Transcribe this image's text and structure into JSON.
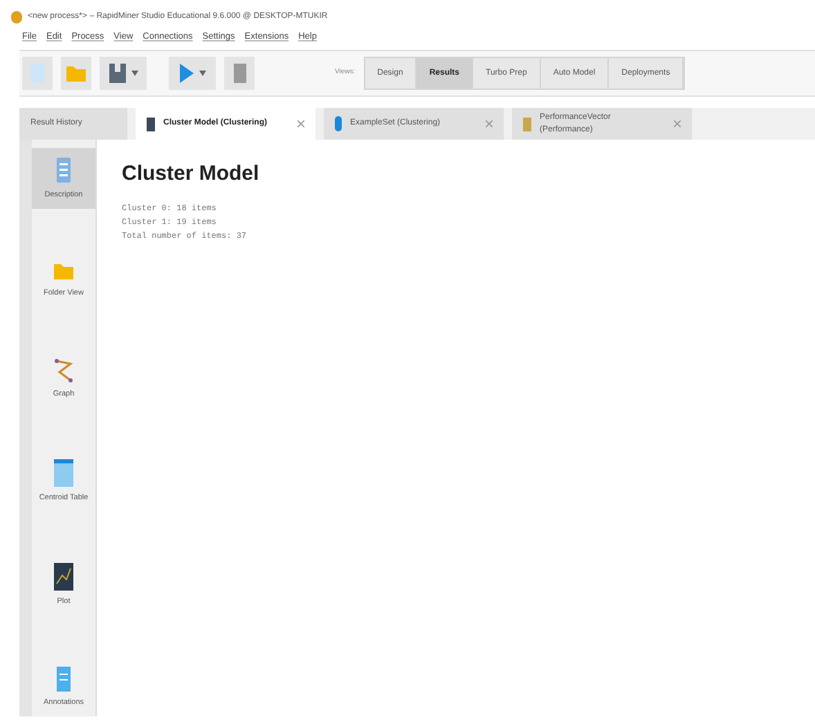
{
  "window": {
    "title": "<new process*> – RapidMiner Studio Educational 9.6.000 @ DESKTOP-MTUKIR"
  },
  "menu": [
    "File",
    "Edit",
    "Process",
    "View",
    "Connections",
    "Settings",
    "Extensions",
    "Help"
  ],
  "views": {
    "label": "Views:",
    "items": [
      {
        "label": "Design",
        "selected": false
      },
      {
        "label": "Results",
        "selected": true
      },
      {
        "label": "Turbo Prep",
        "selected": false
      },
      {
        "label": "Auto Model",
        "selected": false
      },
      {
        "label": "Deployments",
        "selected": false
      }
    ]
  },
  "tabs": [
    {
      "label": "Result History",
      "kind": "plain",
      "selected": false
    },
    {
      "label": "Cluster Model (Clustering)",
      "kind": "model",
      "selected": true
    },
    {
      "label": "ExampleSet (Clustering)",
      "kind": "data",
      "selected": false
    },
    {
      "label": "PerformanceVector (Performance)",
      "kind": "performance",
      "selected": false
    }
  ],
  "sidebar": {
    "items": [
      {
        "label": "Description",
        "kind": "description",
        "selected": true
      },
      {
        "label": "Folder View",
        "kind": "folder",
        "selected": false
      },
      {
        "label": "Graph",
        "kind": "graph",
        "selected": false
      },
      {
        "label": "Centroid Table",
        "kind": "table",
        "selected": false
      },
      {
        "label": "Plot",
        "kind": "plot",
        "selected": false
      },
      {
        "label": "Annotations",
        "kind": "annotations",
        "selected": false
      }
    ]
  },
  "content": {
    "title": "Cluster Model",
    "lines": [
      "Cluster 0: 18 items",
      "Cluster 1: 19 items",
      "Total number of items: 37"
    ]
  }
}
